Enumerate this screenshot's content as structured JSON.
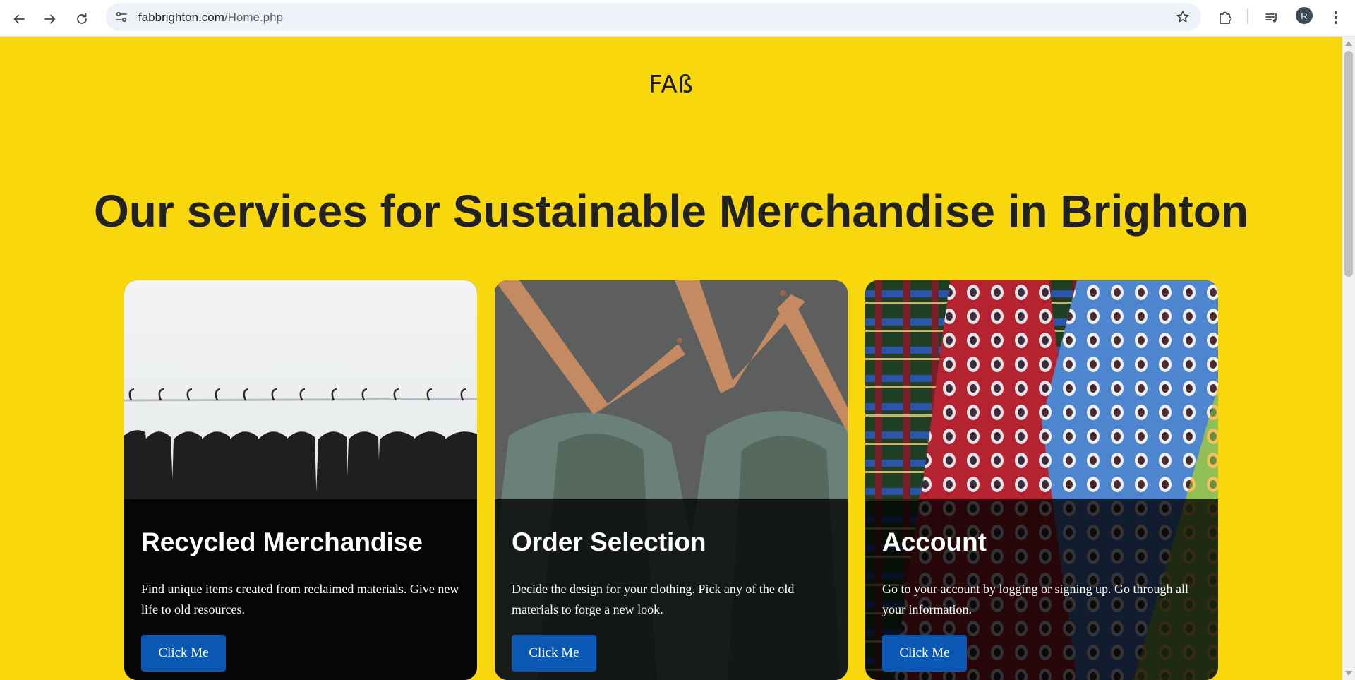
{
  "browser": {
    "url_domain": "fabbrighton.com",
    "url_path": "/Home.php",
    "profile_initial": "R"
  },
  "icons": {
    "back": "arrow-left-icon",
    "forward": "arrow-right-icon",
    "reload": "reload-icon",
    "site_info": "site-settings-icon",
    "bookmark": "star-icon",
    "extensions": "puzzle-icon",
    "media": "media-queue-icon",
    "menu": "kebab-menu-icon"
  },
  "page": {
    "logo": "FAß",
    "headline": "Our services for Sustainable Merchandise in Brighton",
    "background_color": "#f8d80c",
    "button_color": "#0b57b4",
    "cards": [
      {
        "title": "Recycled Merchandise",
        "text": "Find unique items created from reclaimed materials. Give new life to old resources.",
        "button": "Click Me",
        "image": "black-shirts-on-hangers-photo"
      },
      {
        "title": "Order Selection",
        "text": "Decide the design for your clothing. Pick any of the old materials to forge a new look.",
        "button": "Click Me",
        "image": "green-shirts-on-wooden-hangers-photo"
      },
      {
        "title": "Account",
        "text": "Go to your account by logging or signing up. Go through all your information.",
        "button": "Click Me",
        "image": "patterned-neckties-photo"
      }
    ]
  }
}
